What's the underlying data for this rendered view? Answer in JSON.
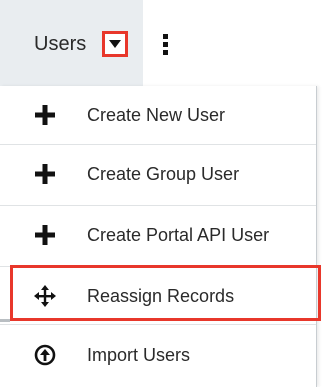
{
  "nav": {
    "users_tab": {
      "label": "Users",
      "caret_icon": "caret-down-icon"
    },
    "more_icon": "vertical-ellipsis-icon"
  },
  "menu": {
    "items": [
      {
        "label": "Create New User",
        "icon": "plus-icon"
      },
      {
        "label": "Create Group User",
        "icon": "plus-icon"
      },
      {
        "label": "Create Portal API User",
        "icon": "plus-icon"
      },
      {
        "label": "Reassign Records",
        "icon": "move-arrows-icon",
        "highlighted": true
      },
      {
        "label": "Import Users",
        "icon": "circle-up-arrow-icon"
      }
    ]
  },
  "colors": {
    "highlight": "#e8372b",
    "tab_background": "#e9edf0",
    "text": "#2a2a2a"
  }
}
